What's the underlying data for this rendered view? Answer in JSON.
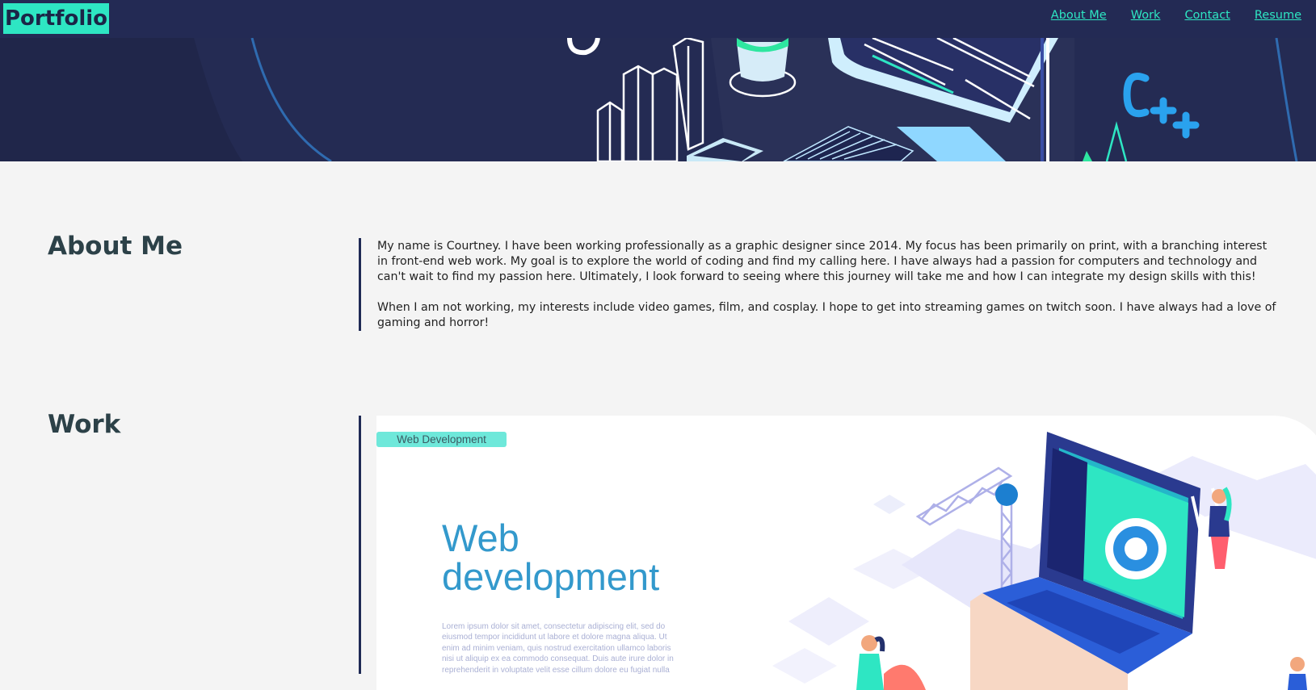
{
  "nav": {
    "logo": "Portfolio",
    "links": [
      "About Me",
      "Work",
      "Contact",
      "Resume"
    ]
  },
  "about": {
    "title": "About Me",
    "paragraphs": [
      "My name is Courtney. I have been working professionally as a graphic designer since 2014. My focus has been primarily on print, with a branching interest in front-end web work. My goal is to explore the world of coding and find my calling here. I have always had a passion for computers and technology and can't wait to find my passion here. Ultimately, I look forward to seeing where this journey will take me and how I can integrate my design skills with this!",
      "When I am not working, my interests include video games, film, and cosplay. I hope to get into streaming games on twitch soon. I have always had a love of gaming and horror!"
    ]
  },
  "work": {
    "title": "Work",
    "badge": "Web Development",
    "card_heading": "Web development",
    "card_text": "Lorem ipsum dolor sit amet, consectetur adipiscing elit, sed do eiusmod tempor incididunt ut labore et dolore magna aliqua. Ut enim ad minim veniam, quis nostrud exercitation ullamco laboris nisi ut aliquip ex ea commodo consequat. Duis aute irure dolor in reprehenderit in voluptate velit esse cillum dolore eu fugiat nulla"
  },
  "colors": {
    "nav_bg": "#232a54",
    "accent": "#2ee6c3",
    "page_bg": "#f4f4f4",
    "heading": "#2c4148",
    "card_heading": "#3399cc"
  },
  "icons": [
    "cpp-logo-icon",
    "bar-chart-icon",
    "monitor-icon",
    "plant-pot-icon",
    "keyboard-icon",
    "laptop-icon",
    "crane-icon",
    "person-icon"
  ]
}
